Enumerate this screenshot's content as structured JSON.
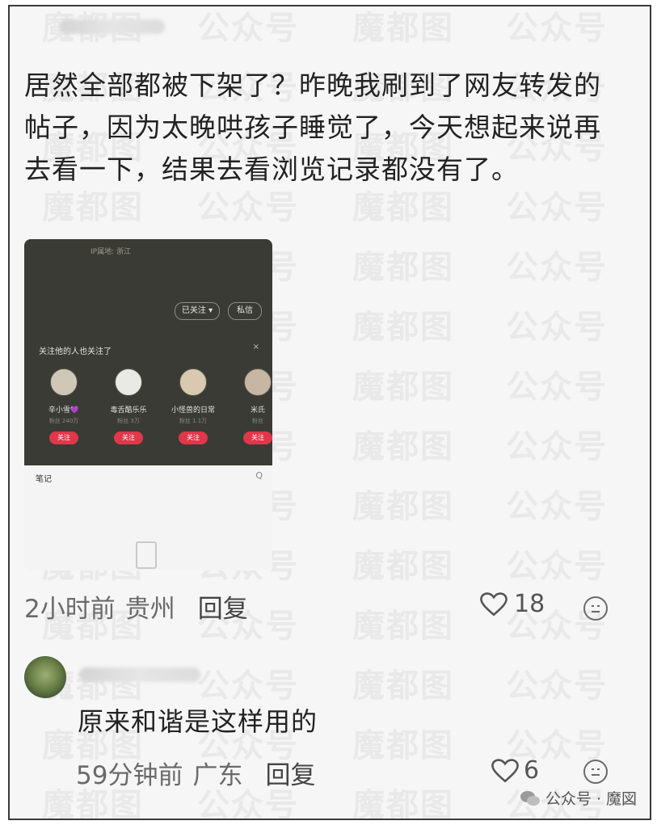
{
  "comment1": {
    "text": "居然全部都被下架了？昨晚我刷到了网友转发的帖子，因为太晚哄孩子睡觉了，今天想起来说再去看一下，结果去看浏览记录都没有了。",
    "time": "2小时前",
    "location": "贵州",
    "reply_label": "回复",
    "likes": "18"
  },
  "screenshot": {
    "top_text": "IP属地: 浙江",
    "btn_following": "已关注 ▾",
    "btn_message": "私信",
    "follow_title": "关注他的人也关注了",
    "close": "×",
    "users": [
      {
        "name": "辛小雪💜",
        "sub": "粉丝 240万",
        "btn": "关注"
      },
      {
        "name": "毒舌酷乐乐",
        "sub": "粉丝 3万",
        "btn": "关注"
      },
      {
        "name": "小怪兽的日常",
        "sub": "粉丝 1.1万",
        "btn": "关注"
      },
      {
        "name": "米氏",
        "sub": "粉丝",
        "btn": "关注"
      }
    ],
    "note_tab": "笔记",
    "search": "Q"
  },
  "comment2": {
    "text": "原来和谐是这样用的",
    "time": "59分钟前",
    "location": "广东",
    "reply_label": "回复",
    "likes": "6"
  },
  "watermark": {
    "text1": "魔都图",
    "text2": "公众号"
  },
  "footer": {
    "text": "公众号 · 魔図"
  }
}
